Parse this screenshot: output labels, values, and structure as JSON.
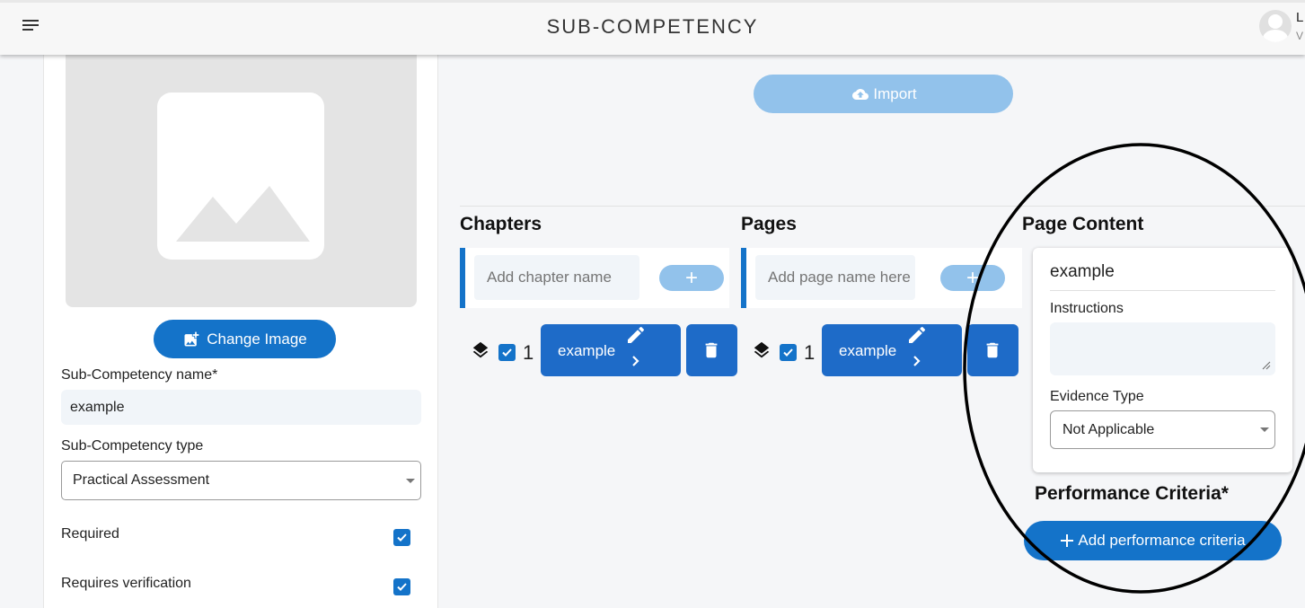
{
  "header": {
    "title": "SUB-COMPETENCY",
    "user_initial": "L",
    "user_sub": "V"
  },
  "left_panel": {
    "change_image_label": "Change Image",
    "name_label": "Sub-Competency name*",
    "name_value": "example",
    "type_label": "Sub-Competency type",
    "type_value": "Practical Assessment",
    "required_label": "Required",
    "required_checked": true,
    "verification_label": "Requires verification",
    "verification_checked": true
  },
  "toolbar": {
    "import_label": "Import"
  },
  "chapters": {
    "heading": "Chapters",
    "input_placeholder": "Add chapter name",
    "add_label": "+",
    "items": [
      {
        "number": "1",
        "label": "example",
        "checked": true
      }
    ]
  },
  "pages": {
    "heading": "Pages",
    "input_placeholder": "Add page name here",
    "add_label": "+",
    "items": [
      {
        "number": "1",
        "label": "example",
        "checked": true
      }
    ]
  },
  "page_content": {
    "heading": "Page Content",
    "title_value": "example",
    "instructions_label": "Instructions",
    "instructions_value": "",
    "evidence_label": "Evidence Type",
    "evidence_value": "Not Applicable"
  },
  "performance_criteria": {
    "heading": "Performance Criteria*",
    "add_label": "Add performance criteria"
  },
  "colors": {
    "primary": "#1473c9",
    "primary_light": "#92c2eb",
    "item_button": "#1e6bc8",
    "input_bg": "#f1f5f9",
    "annotation": "#000000"
  }
}
